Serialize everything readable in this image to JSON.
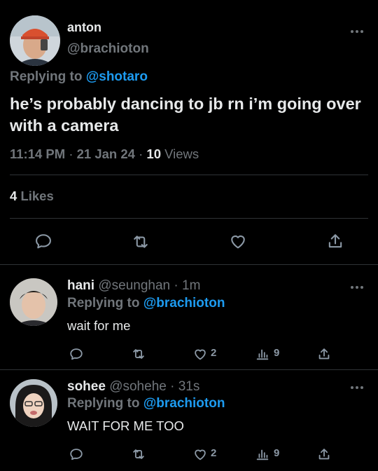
{
  "main_tweet": {
    "display_name": "anton",
    "handle": "@brachioton",
    "replying_prefix": "Replying to",
    "replying_to": "@shotaro",
    "text": "he’s probably dancing to jb rn i’m going over with a camera",
    "time": "11:14 PM",
    "date": "21 Jan 24",
    "views_count": "10",
    "views_label": "Views",
    "likes_count": "4",
    "likes_label": "Likes"
  },
  "replies": [
    {
      "display_name": "hani",
      "handle": "@seunghan",
      "age": "1m",
      "replying_prefix": "Replying to",
      "replying_to": "@brachioton",
      "text": "wait for me",
      "like_count": "2",
      "views_count": "9"
    },
    {
      "display_name": "sohee",
      "handle": "@sohehe",
      "age": "31s",
      "replying_prefix": "Replying to",
      "replying_to": "@brachioton",
      "text": "WAIT FOR ME TOO",
      "like_count": "2",
      "views_count": "9"
    }
  ],
  "icons": [
    "reply-icon",
    "retweet-icon",
    "like-icon",
    "share-icon",
    "views-icon",
    "more-icon"
  ],
  "colors": {
    "background": "#000000",
    "text": "#e7e9ea",
    "muted": "#71767b",
    "accent": "#1d9bf0",
    "divider": "#2f3336"
  }
}
